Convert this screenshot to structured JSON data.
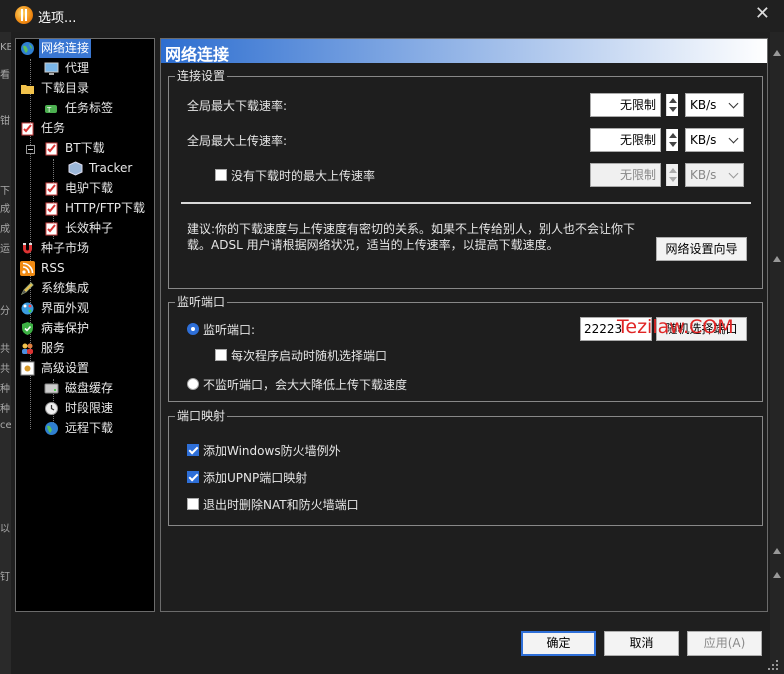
{
  "window": {
    "title": "选项...",
    "close": "✕"
  },
  "left_edge": [
    "KB",
    "看",
    "钳",
    "下",
    "成",
    "成",
    "运",
    "分",
    "共",
    "共",
    "种",
    "种",
    "ce",
    "以",
    "钉"
  ],
  "tree": {
    "items": [
      {
        "label": "网络连接",
        "icon": "globe-icon",
        "selected": true
      },
      {
        "label": "代理",
        "icon": "computer-icon"
      },
      {
        "label": "下载目录",
        "icon": "folder-icon"
      },
      {
        "label": "任务标签",
        "icon": "tag-icon"
      },
      {
        "label": "任务",
        "icon": "task-icon"
      },
      {
        "label": "BT下载",
        "icon": "task-icon"
      },
      {
        "label": "Tracker",
        "icon": "cube-icon"
      },
      {
        "label": "电驴下载",
        "icon": "task-icon"
      },
      {
        "label": "HTTP/FTP下载",
        "icon": "task-icon"
      },
      {
        "label": "长效种子",
        "icon": "task-icon"
      },
      {
        "label": "种子市场",
        "icon": "magnet-icon"
      },
      {
        "label": "RSS",
        "icon": "rss-icon"
      },
      {
        "label": "系统集成",
        "icon": "pencil-icon"
      },
      {
        "label": "界面外观",
        "icon": "palette-icon"
      },
      {
        "label": "病毒保护",
        "icon": "shield-icon"
      },
      {
        "label": "服务",
        "icon": "people-icon"
      },
      {
        "label": "高级设置",
        "icon": "advanced-icon"
      },
      {
        "label": "磁盘缓存",
        "icon": "disk-icon"
      },
      {
        "label": "时段限速",
        "icon": "clock-icon"
      },
      {
        "label": "远程下载",
        "icon": "remote-icon"
      }
    ]
  },
  "panel": {
    "title": "网络连接",
    "connection": {
      "group_title": "连接设置",
      "download_label": "全局最大下载速率:",
      "download_value": "无限制",
      "download_unit": "KB/s",
      "upload_label": "全局最大上传速率:",
      "upload_value": "无限制",
      "upload_unit": "KB/s",
      "idle_checkbox_label": "没有下载时的最大上传速率",
      "idle_checked": false,
      "idle_value": "无限制",
      "idle_unit": "KB/s",
      "advice": "建议:你的下载速度与上传速度有密切的关系。如果不上传给别人，别人也不会让你下载。ADSL 用户请根据网络状况，适当的上传速率，以提高下载速度。",
      "advice_line1": "建议:你的下载速度与上传速度有密切的关系。如果不上传给别人，别人也不会让你下",
      "advice_line2": "载。ADSL 用户请根据网络状况，适当的上传速率，以提高下载速度。",
      "wizard_button": "网络设置向导"
    },
    "listen": {
      "group_title": "监听端口",
      "listen_radio_label": "监听端口:",
      "listen_checked": true,
      "port_value": "22223",
      "random_button": "随机选择端口",
      "random_checkbox_label": "每次程序启动时随机选择端口",
      "random_checked": false,
      "no_listen_label": "不监听端口，会大大降低上传下载速度",
      "no_listen_checked": false
    },
    "mapping": {
      "group_title": "端口映射",
      "firewall_label": "添加Windows防火墙例外",
      "firewall_checked": true,
      "upnp_label": "添加UPNP端口映射",
      "upnp_checked": true,
      "remove_label": "退出时删除NAT和防火墙端口",
      "remove_checked": false
    }
  },
  "footer": {
    "ok": "确定",
    "cancel": "取消",
    "apply": "应用(A)"
  },
  "watermark": "Tezilaw.COM",
  "colors": {
    "selection": "#3a77d2",
    "header_start": "#2d6ed0",
    "check_accent": "#2e6fd8",
    "watermark": "#e02525"
  }
}
